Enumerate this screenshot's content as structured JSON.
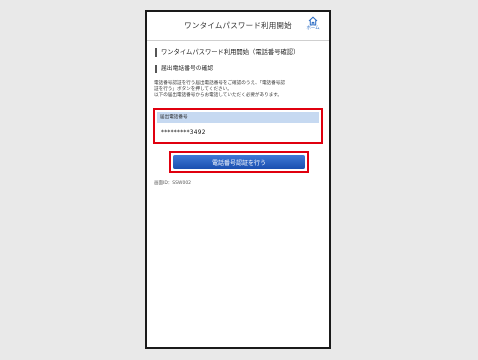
{
  "header": {
    "title": "ワンタイムパスワード利用開始",
    "home_label": "ホーム",
    "home_icon": "home-icon"
  },
  "page": {
    "section_title": "ワンタイムパスワード利用開始（電話番号確認）",
    "sub_title": "届出電話番号の確認",
    "description_lines": [
      "電話番号認証を行う届出電話番号をご確認のうえ、「電話番号認",
      "証を行う」ボタンを押してください。",
      "以下の届出電話番号からお電話していただく必要があります。"
    ],
    "field_label": "届出電話番号",
    "phone_number": "*********3492",
    "verify_button_label": "電話番号認証を行う",
    "screen_id": "画面ID：SSW002"
  },
  "colors": {
    "highlight": "#e0000f",
    "button": "#1a4fb0",
    "field_label_bg": "#c6d9f1",
    "accent": "#2b6cc4"
  }
}
